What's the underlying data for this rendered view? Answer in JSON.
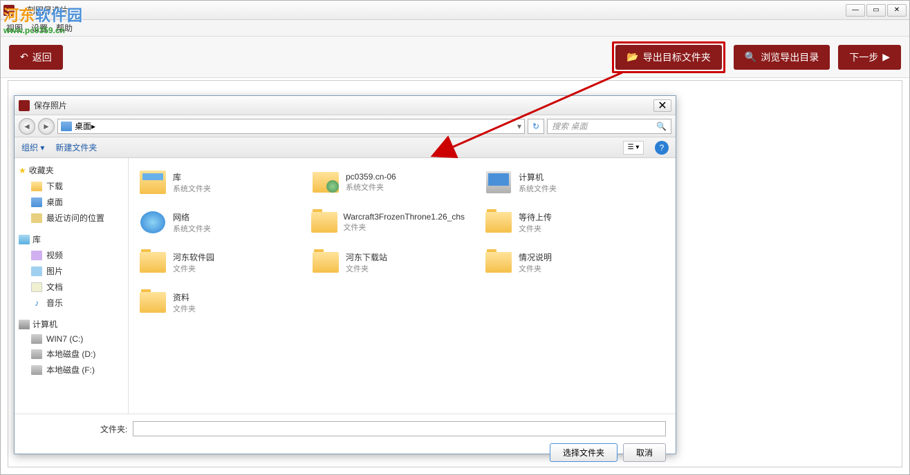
{
  "main_window": {
    "title": "一刻网易选片",
    "menu": {
      "view": "视图",
      "settings": "设置",
      "help": "帮助"
    },
    "toolbar": {
      "back": "返回",
      "export_target": "导出目标文件夹",
      "browse_export": "浏览导出目录",
      "next": "下一步"
    }
  },
  "watermark": {
    "text_prefix": "河东",
    "text_suffix": "软件园",
    "url": "www.pc0359.cn"
  },
  "dialog": {
    "title": "保存照片",
    "nav": {
      "path": "桌面",
      "search_placeholder": "搜索 桌面"
    },
    "toolbar": {
      "organize": "组织",
      "new_folder": "新建文件夹"
    },
    "sidebar": {
      "favorites": {
        "label": "收藏夹",
        "items": [
          {
            "icon": "download",
            "label": "下载"
          },
          {
            "icon": "desktop",
            "label": "桌面"
          },
          {
            "icon": "recent",
            "label": "最近访问的位置"
          }
        ]
      },
      "libraries": {
        "label": "库",
        "items": [
          {
            "icon": "video",
            "label": "视频"
          },
          {
            "icon": "picture",
            "label": "图片"
          },
          {
            "icon": "document",
            "label": "文档"
          },
          {
            "icon": "music",
            "label": "音乐"
          }
        ]
      },
      "computer": {
        "label": "计算机",
        "items": [
          {
            "icon": "drive",
            "label": "WIN7 (C:)"
          },
          {
            "icon": "drive",
            "label": "本地磁盘 (D:)"
          },
          {
            "icon": "drive",
            "label": "本地磁盘 (F:)"
          }
        ]
      }
    },
    "files": [
      {
        "icon": "library",
        "name": "库",
        "type": "系统文件夹"
      },
      {
        "icon": "user-folder",
        "name": "pc0359.cn-06",
        "type": "系统文件夹"
      },
      {
        "icon": "computer",
        "name": "计算机",
        "type": "系统文件夹"
      },
      {
        "icon": "network",
        "name": "网络",
        "type": "系统文件夹"
      },
      {
        "icon": "folder",
        "name": "Warcraft3FrozenThrone1.26_chs",
        "type": "文件夹"
      },
      {
        "icon": "folder",
        "name": "等待上传",
        "type": "文件夹"
      },
      {
        "icon": "folder",
        "name": "河东软件园",
        "type": "文件夹"
      },
      {
        "icon": "folder",
        "name": "河东下载站",
        "type": "文件夹"
      },
      {
        "icon": "folder",
        "name": "情况说明",
        "type": "文件夹"
      },
      {
        "icon": "folder",
        "name": "资料",
        "type": "文件夹"
      }
    ],
    "footer": {
      "folder_label": "文件夹:",
      "folder_value": "",
      "select_btn": "选择文件夹",
      "cancel_btn": "取消"
    }
  }
}
